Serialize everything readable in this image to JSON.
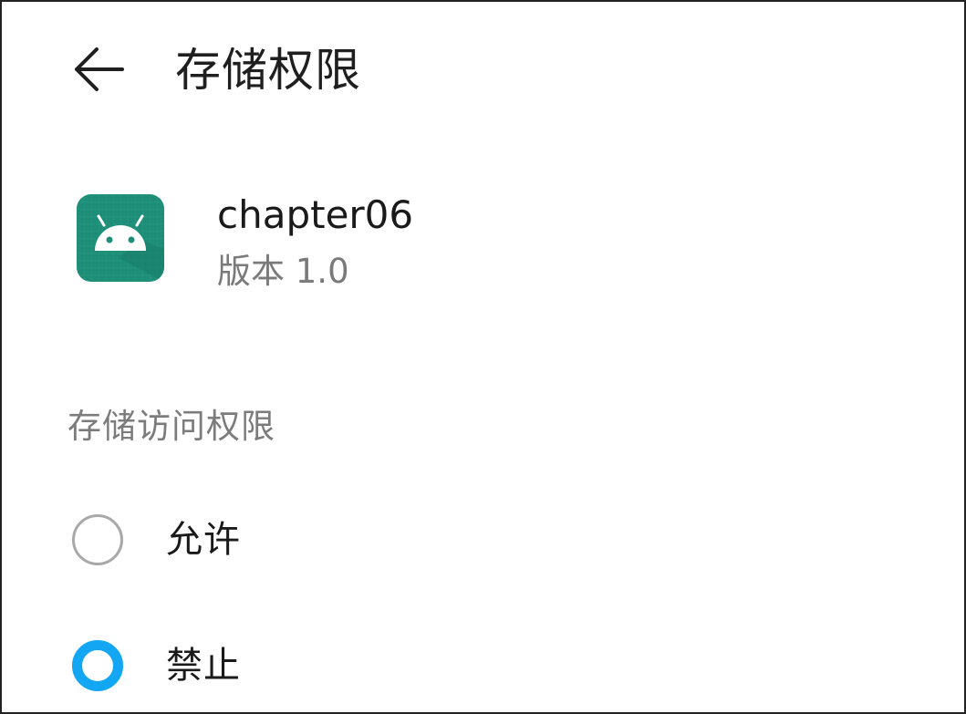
{
  "header": {
    "title": "存储权限",
    "back_icon": "arrow-left-icon"
  },
  "app": {
    "name": "chapter06",
    "version": "版本 1.0",
    "icon": "android-app-icon",
    "icon_color": "#1e8e79"
  },
  "permission": {
    "section_label": "存储访问权限",
    "options": [
      {
        "label": "允许",
        "selected": false
      },
      {
        "label": "禁止",
        "selected": true
      }
    ],
    "accent_color": "#13a6f2"
  }
}
